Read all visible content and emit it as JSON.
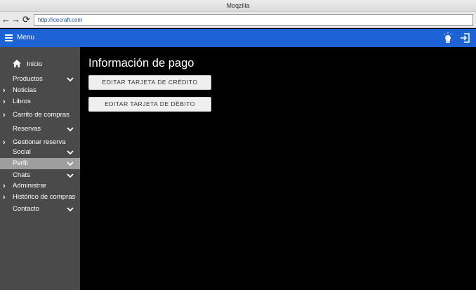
{
  "browser": {
    "title": "Moqzilla",
    "url": "http://icecraft.com"
  },
  "header": {
    "menu_label": "Menu"
  },
  "sidebar": {
    "items": [
      {
        "label": "Inicio"
      },
      {
        "label": "Productos"
      },
      {
        "label": "Noticias"
      },
      {
        "label": "Libros"
      },
      {
        "label": "Carrito de compras"
      },
      {
        "label": "Reservas"
      },
      {
        "label": "Gestionar reserva"
      },
      {
        "label": "Social"
      },
      {
        "label": "Perfil"
      },
      {
        "label": "Chats"
      },
      {
        "label": "Administrar"
      },
      {
        "label": "Histórico de compras"
      },
      {
        "label": "Contacto"
      }
    ]
  },
  "main": {
    "title": "Información de pago",
    "buttons": [
      {
        "label": "EDITAR TARJETA DE CRÉDITO"
      },
      {
        "label": "EDITAR TARJETA DE DÉBITO"
      }
    ]
  },
  "colors": {
    "header": "#1e63d6",
    "sidebar": "#4a4a4a",
    "sidebar_active": "#9e9e9e",
    "main_bg": "#000000"
  }
}
